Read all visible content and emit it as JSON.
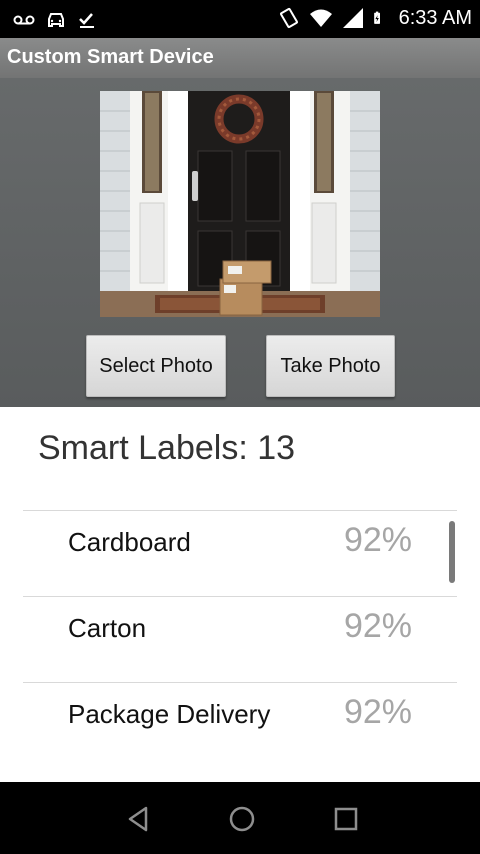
{
  "status_bar": {
    "time": "6:33 AM",
    "icons": [
      "voicemail-icon",
      "car-icon",
      "checkmark-icon",
      "vibrate-icon",
      "wifi-icon",
      "signal-icon",
      "battery-charging-icon"
    ]
  },
  "app": {
    "title": "Custom Smart Device"
  },
  "photo": {
    "description_icon": "front-door-package-photo"
  },
  "buttons": {
    "select_photo": "Select Photo",
    "take_photo": "Take Photo"
  },
  "labels": {
    "heading": "Smart Labels: 13",
    "items": [
      {
        "name": "Cardboard",
        "confidence": "92%"
      },
      {
        "name": "Carton",
        "confidence": "92%"
      },
      {
        "name": "Package Delivery",
        "confidence": "92%"
      }
    ]
  },
  "nav": {
    "icons": [
      "back-icon",
      "home-icon",
      "recents-icon"
    ]
  },
  "colors": {
    "title_bar": "#7d7e7e",
    "photo_bg": "#606364",
    "percent_text": "#a6a6a6"
  }
}
